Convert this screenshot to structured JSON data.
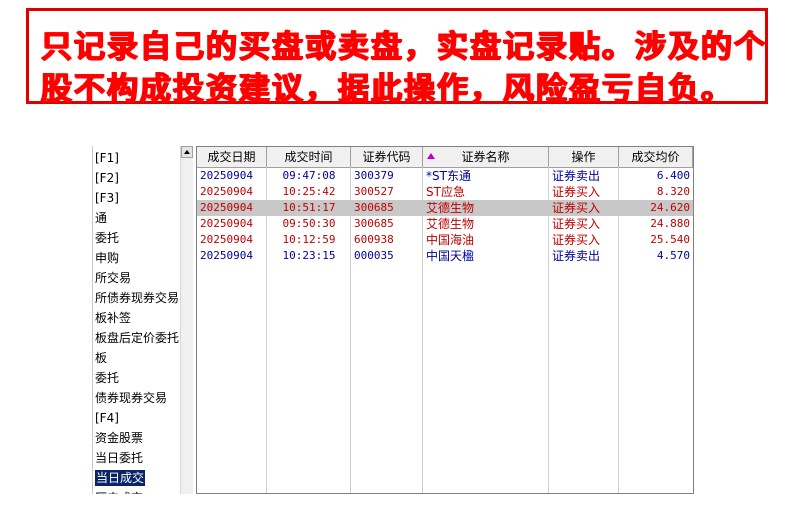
{
  "banner": {
    "line1": "只记录自己的买盘或卖盘，实盘记录贴。涉及的个",
    "line2": "股不构成投资建议，据此操作，风险盈亏自负。"
  },
  "nav": {
    "items": [
      {
        "label": "[F1]"
      },
      {
        "label": "[F2]"
      },
      {
        "label": "[F3]"
      },
      {
        "label": "通"
      },
      {
        "label": "委托"
      },
      {
        "label": "申购"
      },
      {
        "label": "所交易"
      },
      {
        "label": "所债券现券交易"
      },
      {
        "label": "板补签"
      },
      {
        "label": "板盘后定价委托"
      },
      {
        "label": "板"
      },
      {
        "label": "委托"
      },
      {
        "label": "债券现券交易"
      },
      {
        "label": "[F4]"
      },
      {
        "label": "资金股票"
      },
      {
        "label": "当日委托"
      },
      {
        "label": "当日成交",
        "selected": true
      },
      {
        "label": "历史成交"
      }
    ]
  },
  "table": {
    "columns": [
      "成交日期",
      "成交时间",
      "证券代码",
      "证券名称",
      "操作",
      "成交均价"
    ],
    "sort_icon": "sort-ascending-icon",
    "colors": {
      "sell": "#0000a0",
      "buy": "#c00000"
    },
    "rows": [
      {
        "date": "20250904",
        "time": "09:47:08",
        "code": "300379",
        "name": "*ST东通",
        "op": "证券卖出",
        "price": "6.400",
        "side": "sell"
      },
      {
        "date": "20250904",
        "time": "10:25:42",
        "code": "300527",
        "name": "ST应急",
        "op": "证券买入",
        "price": "8.320",
        "side": "buy"
      },
      {
        "date": "20250904",
        "time": "10:51:17",
        "code": "300685",
        "name": "艾德生物",
        "op": "证券买入",
        "price": "24.620",
        "side": "buy",
        "selected": true
      },
      {
        "date": "20250904",
        "time": "09:50:30",
        "code": "300685",
        "name": "艾德生物",
        "op": "证券买入",
        "price": "24.880",
        "side": "buy"
      },
      {
        "date": "20250904",
        "time": "10:12:59",
        "code": "600938",
        "name": "中国海油",
        "op": "证券买入",
        "price": "25.540",
        "side": "buy"
      },
      {
        "date": "20250904",
        "time": "10:23:15",
        "code": "000035",
        "name": "中国天楹",
        "op": "证券卖出",
        "price": "4.570",
        "side": "sell"
      }
    ]
  }
}
